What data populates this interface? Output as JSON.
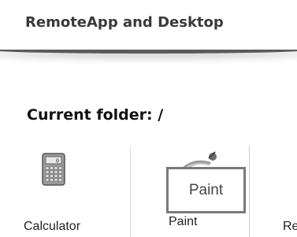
{
  "header": {
    "title": "RemoteApp and Desktop"
  },
  "folder": {
    "label": "Current folder: /"
  },
  "apps": [
    {
      "label": "Calculator",
      "icon": "calculator-icon"
    },
    {
      "label": "Paint",
      "icon": "paint-icon"
    },
    {
      "label": "Re",
      "icon": ""
    }
  ],
  "tooltip": {
    "text": "Paint"
  }
}
